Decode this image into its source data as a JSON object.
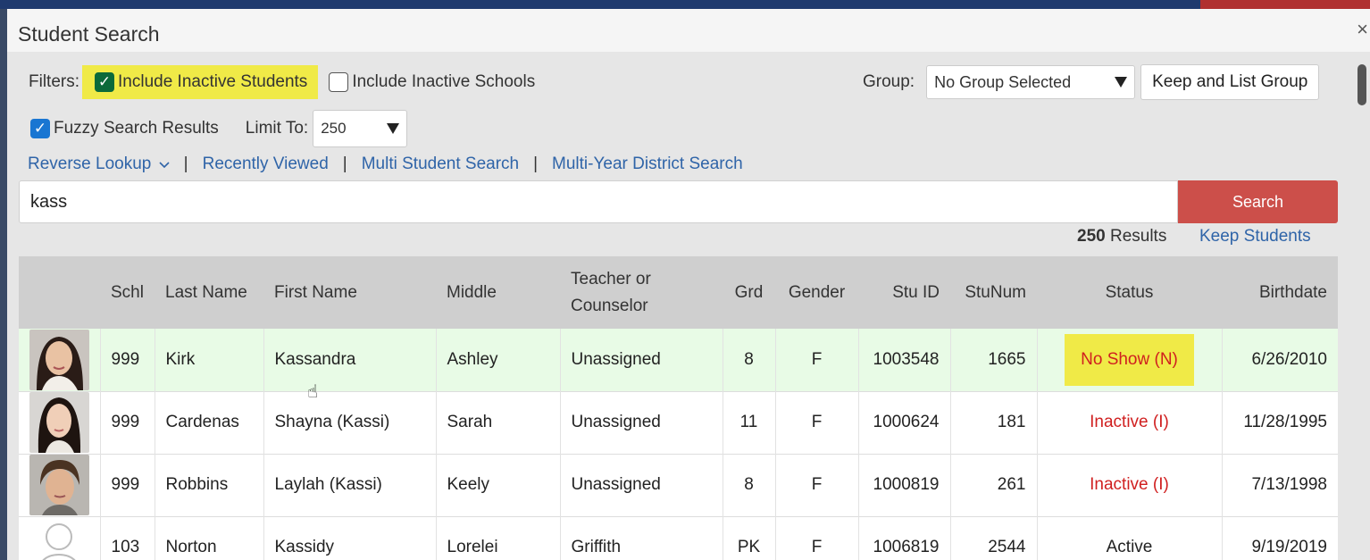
{
  "dialog": {
    "title": "Student Search",
    "close_label": "×"
  },
  "filters": {
    "label": "Filters:",
    "include_inactive_students": {
      "label": "Include Inactive Students",
      "checked": true
    },
    "include_inactive_schools": {
      "label": "Include Inactive Schools",
      "checked": false
    },
    "fuzzy_search": {
      "label": "Fuzzy Search Results",
      "checked": true
    },
    "limit_label": "Limit To:",
    "limit_value": "250"
  },
  "group": {
    "label": "Group:",
    "selected": "No Group Selected",
    "keep_button": "Keep and List Group"
  },
  "links": {
    "reverse_lookup": "Reverse Lookup",
    "recently_viewed": "Recently Viewed",
    "multi_student": "Multi Student Search",
    "multi_year": "Multi-Year District Search",
    "separator": "|"
  },
  "search": {
    "value": "kass",
    "button": "Search"
  },
  "results": {
    "count": "250",
    "label": "Results",
    "keep_students": "Keep Students"
  },
  "table": {
    "headers": {
      "schl": "Schl",
      "last": "Last Name",
      "first": "First Name",
      "middle": "Middle",
      "teacher_l1": "Teacher or",
      "teacher_l2": "Counselor",
      "grd": "Grd",
      "gender": "Gender",
      "stuid": "Stu ID",
      "stunum": "StuNum",
      "status": "Status",
      "birthdate": "Birthdate"
    },
    "rows": [
      {
        "schl": "999",
        "last": "Kirk",
        "first": "Kassandra",
        "middle": "Ashley",
        "teacher": "Unassigned",
        "grd": "8",
        "gender": "F",
        "stuid": "1003548",
        "stunum": "1665",
        "status": "No Show (N)",
        "birthdate": "6/26/2010"
      },
      {
        "schl": "999",
        "last": "Cardenas",
        "first": "Shayna (Kassi)",
        "middle": "Sarah",
        "teacher": "Unassigned",
        "grd": "11",
        "gender": "F",
        "stuid": "1000624",
        "stunum": "181",
        "status": "Inactive (I)",
        "birthdate": "11/28/1995"
      },
      {
        "schl": "999",
        "last": "Robbins",
        "first": "Laylah (Kassi)",
        "middle": "Keely",
        "teacher": "Unassigned",
        "grd": "8",
        "gender": "F",
        "stuid": "1000819",
        "stunum": "261",
        "status": "Inactive (I)",
        "birthdate": "7/13/1998"
      },
      {
        "schl": "103",
        "last": "Norton",
        "first": "Kassidy",
        "middle": "Lorelei",
        "teacher": "Griffith",
        "grd": "PK",
        "gender": "F",
        "stuid": "1006819",
        "stunum": "2544",
        "status": "Active",
        "birthdate": "9/19/2019"
      }
    ]
  },
  "colors": {
    "accent_link": "#2f64a8",
    "search_button": "#cc4f4a",
    "highlight": "#f0ea47",
    "status_red": "#d01f1f"
  }
}
